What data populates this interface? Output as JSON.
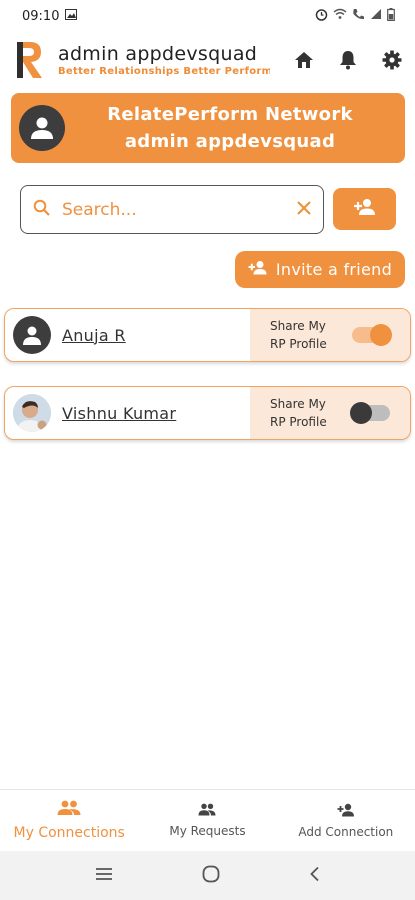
{
  "status": {
    "time": "09:10"
  },
  "header": {
    "title": "admin appdevsquad",
    "subtitle": "Better Relationships Better Performance"
  },
  "banner": {
    "line1": "RelatePerform Network",
    "line2": "admin appdevsquad"
  },
  "search": {
    "placeholder": "Search...",
    "value": ""
  },
  "invite": {
    "label": "Invite a friend"
  },
  "connections": [
    {
      "name": "Anuja R",
      "share_label_1": "Share My",
      "share_label_2": "RP Profile",
      "shared": true
    },
    {
      "name": "Vishnu Kumar",
      "share_label_1": "Share My",
      "share_label_2": "RP Profile",
      "shared": false
    }
  ],
  "bottom_nav": [
    {
      "label": "My Connections",
      "icon": "people-icon",
      "active": true
    },
    {
      "label": "My Requests",
      "icon": "people-icon",
      "active": false
    },
    {
      "label": "Add Connection",
      "icon": "person-add-icon",
      "active": false
    }
  ],
  "colors": {
    "accent": "#f0913f",
    "accent_light": "#fce8d8",
    "avatar_dark": "#3d3d3d"
  }
}
